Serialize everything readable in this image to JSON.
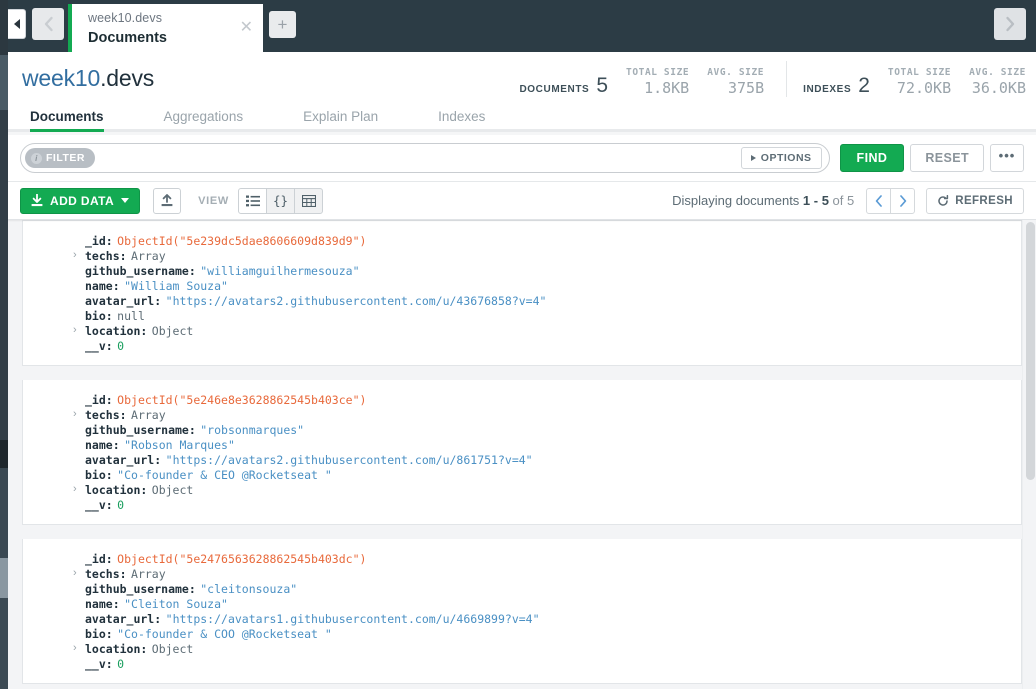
{
  "window": {
    "tab": {
      "namespace": "week10.devs",
      "title": "Documents",
      "close_icon": "close-icon",
      "add_icon": "+"
    },
    "nav": {
      "collapse_icon": "collapse-left-icon",
      "back_icon": "chevron-left-icon",
      "forward_icon": "chevron-right-icon"
    }
  },
  "header": {
    "db_name": "week10",
    "collection_name": ".devs",
    "stats": {
      "documents": {
        "label": "DOCUMENTS",
        "count": "5",
        "total_size_label": "TOTAL SIZE",
        "total_size": "1.8KB",
        "avg_size_label": "AVG. SIZE",
        "avg_size": "375B"
      },
      "indexes": {
        "label": "INDEXES",
        "count": "2",
        "total_size_label": "TOTAL SIZE",
        "total_size": "72.0KB",
        "avg_size_label": "AVG. SIZE",
        "avg_size": "36.0KB"
      }
    }
  },
  "tabs": [
    {
      "label": "Documents",
      "active": true
    },
    {
      "label": "Aggregations",
      "active": false
    },
    {
      "label": "Explain Plan",
      "active": false
    },
    {
      "label": "Indexes",
      "active": false
    }
  ],
  "querybar": {
    "filter_badge": "FILTER",
    "filter_info_icon": "info-icon",
    "filter_value": "",
    "filter_placeholder": "",
    "options_label": "OPTIONS",
    "find_label": "FIND",
    "reset_label": "RESET",
    "more_label": "•••"
  },
  "toolbar": {
    "add_data_label": "ADD DATA",
    "add_data_icon": "download-icon",
    "export_icon": "export-icon",
    "view_label": "VIEW",
    "view_modes": [
      {
        "name": "list-view",
        "icon": "list-icon",
        "active": true
      },
      {
        "name": "json-view",
        "icon": "braces-icon",
        "active": false
      },
      {
        "name": "table-view",
        "icon": "table-icon",
        "active": false
      }
    ],
    "displaying_prefix": "Displaying documents ",
    "displaying_range": "1 - 5",
    "displaying_suffix": " of 5",
    "prev_icon": "chevron-left-icon",
    "next_icon": "chevron-right-icon",
    "refresh_label": "REFRESH",
    "refresh_icon": "refresh-icon"
  },
  "documents": [
    {
      "fields": [
        {
          "key": "_id",
          "value": "ObjectId(\"5e239dc5dae8606609d839d9\")",
          "type": "objectid",
          "expandable": false
        },
        {
          "key": "techs",
          "value": "Array",
          "type": "type",
          "expandable": true
        },
        {
          "key": "github_username",
          "value": "\"williamguilhermesouza\"",
          "type": "string",
          "expandable": false
        },
        {
          "key": "name",
          "value": "\"William Souza\"",
          "type": "string",
          "expandable": false
        },
        {
          "key": "avatar_url",
          "value": "\"https://avatars2.githubusercontent.com/u/43676858?v=4\"",
          "type": "string",
          "expandable": false
        },
        {
          "key": "bio",
          "value": "null",
          "type": "null",
          "expandable": false
        },
        {
          "key": "location",
          "value": "Object",
          "type": "type",
          "expandable": true
        },
        {
          "key": "__v",
          "value": "0",
          "type": "num",
          "expandable": false
        }
      ]
    },
    {
      "fields": [
        {
          "key": "_id",
          "value": "ObjectId(\"5e246e8e3628862545b403ce\")",
          "type": "objectid",
          "expandable": false
        },
        {
          "key": "techs",
          "value": "Array",
          "type": "type",
          "expandable": true
        },
        {
          "key": "github_username",
          "value": "\"robsonmarques\"",
          "type": "string",
          "expandable": false
        },
        {
          "key": "name",
          "value": "\"Robson Marques\"",
          "type": "string",
          "expandable": false
        },
        {
          "key": "avatar_url",
          "value": "\"https://avatars2.githubusercontent.com/u/861751?v=4\"",
          "type": "string",
          "expandable": false
        },
        {
          "key": "bio",
          "value": "\"Co-founder & CEO @Rocketseat \"",
          "type": "string",
          "expandable": false
        },
        {
          "key": "location",
          "value": "Object",
          "type": "type",
          "expandable": true
        },
        {
          "key": "__v",
          "value": "0",
          "type": "num",
          "expandable": false
        }
      ]
    },
    {
      "fields": [
        {
          "key": "_id",
          "value": "ObjectId(\"5e2476563628862545b403dc\")",
          "type": "objectid",
          "expandable": false
        },
        {
          "key": "techs",
          "value": "Array",
          "type": "type",
          "expandable": true
        },
        {
          "key": "github_username",
          "value": "\"cleitonsouza\"",
          "type": "string",
          "expandable": false
        },
        {
          "key": "name",
          "value": "\"Cleiton Souza\"",
          "type": "string",
          "expandable": false
        },
        {
          "key": "avatar_url",
          "value": "\"https://avatars1.githubusercontent.com/u/4669899?v=4\"",
          "type": "string",
          "expandable": false
        },
        {
          "key": "bio",
          "value": "\"Co-founder & COO @Rocketseat \"",
          "type": "string",
          "expandable": false
        },
        {
          "key": "location",
          "value": "Object",
          "type": "type",
          "expandable": true
        },
        {
          "key": "__v",
          "value": "0",
          "type": "num",
          "expandable": false
        }
      ]
    }
  ],
  "colors": {
    "brand_green": "#13aa52",
    "tabbar_dark": "#2c3c45",
    "db_blue": "#326ea0",
    "objectid_orange": "#e8693b",
    "string_blue": "#4a90c4",
    "number_green": "#1a9e5e"
  }
}
